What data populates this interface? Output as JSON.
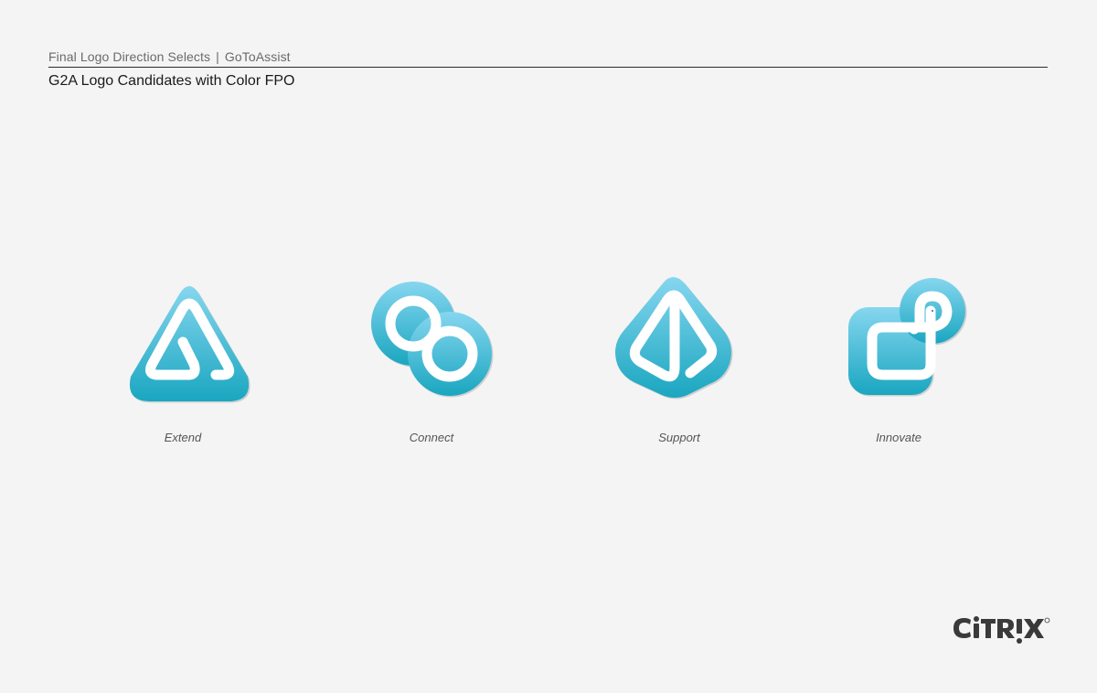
{
  "header": {
    "subtitle_left": "Final Logo Direction Selects",
    "subtitle_sep": "|",
    "subtitle_right": "GoToAssist",
    "title": "G2A Logo Candidates with Color FPO"
  },
  "candidates": [
    {
      "label": "Extend",
      "icon": "extend-logo-icon"
    },
    {
      "label": "Connect",
      "icon": "connect-logo-icon"
    },
    {
      "label": "Support",
      "icon": "support-logo-icon"
    },
    {
      "label": "Innovate",
      "icon": "innovate-logo-icon"
    }
  ],
  "brand": {
    "name": "CiTRiX",
    "icon": "citrix-wordmark"
  },
  "colors": {
    "background": "#f4f4f4",
    "logo_gradient_top": "#86d6ef",
    "logo_gradient_bottom": "#1aa6c0",
    "rule": "#2b2b2b"
  }
}
